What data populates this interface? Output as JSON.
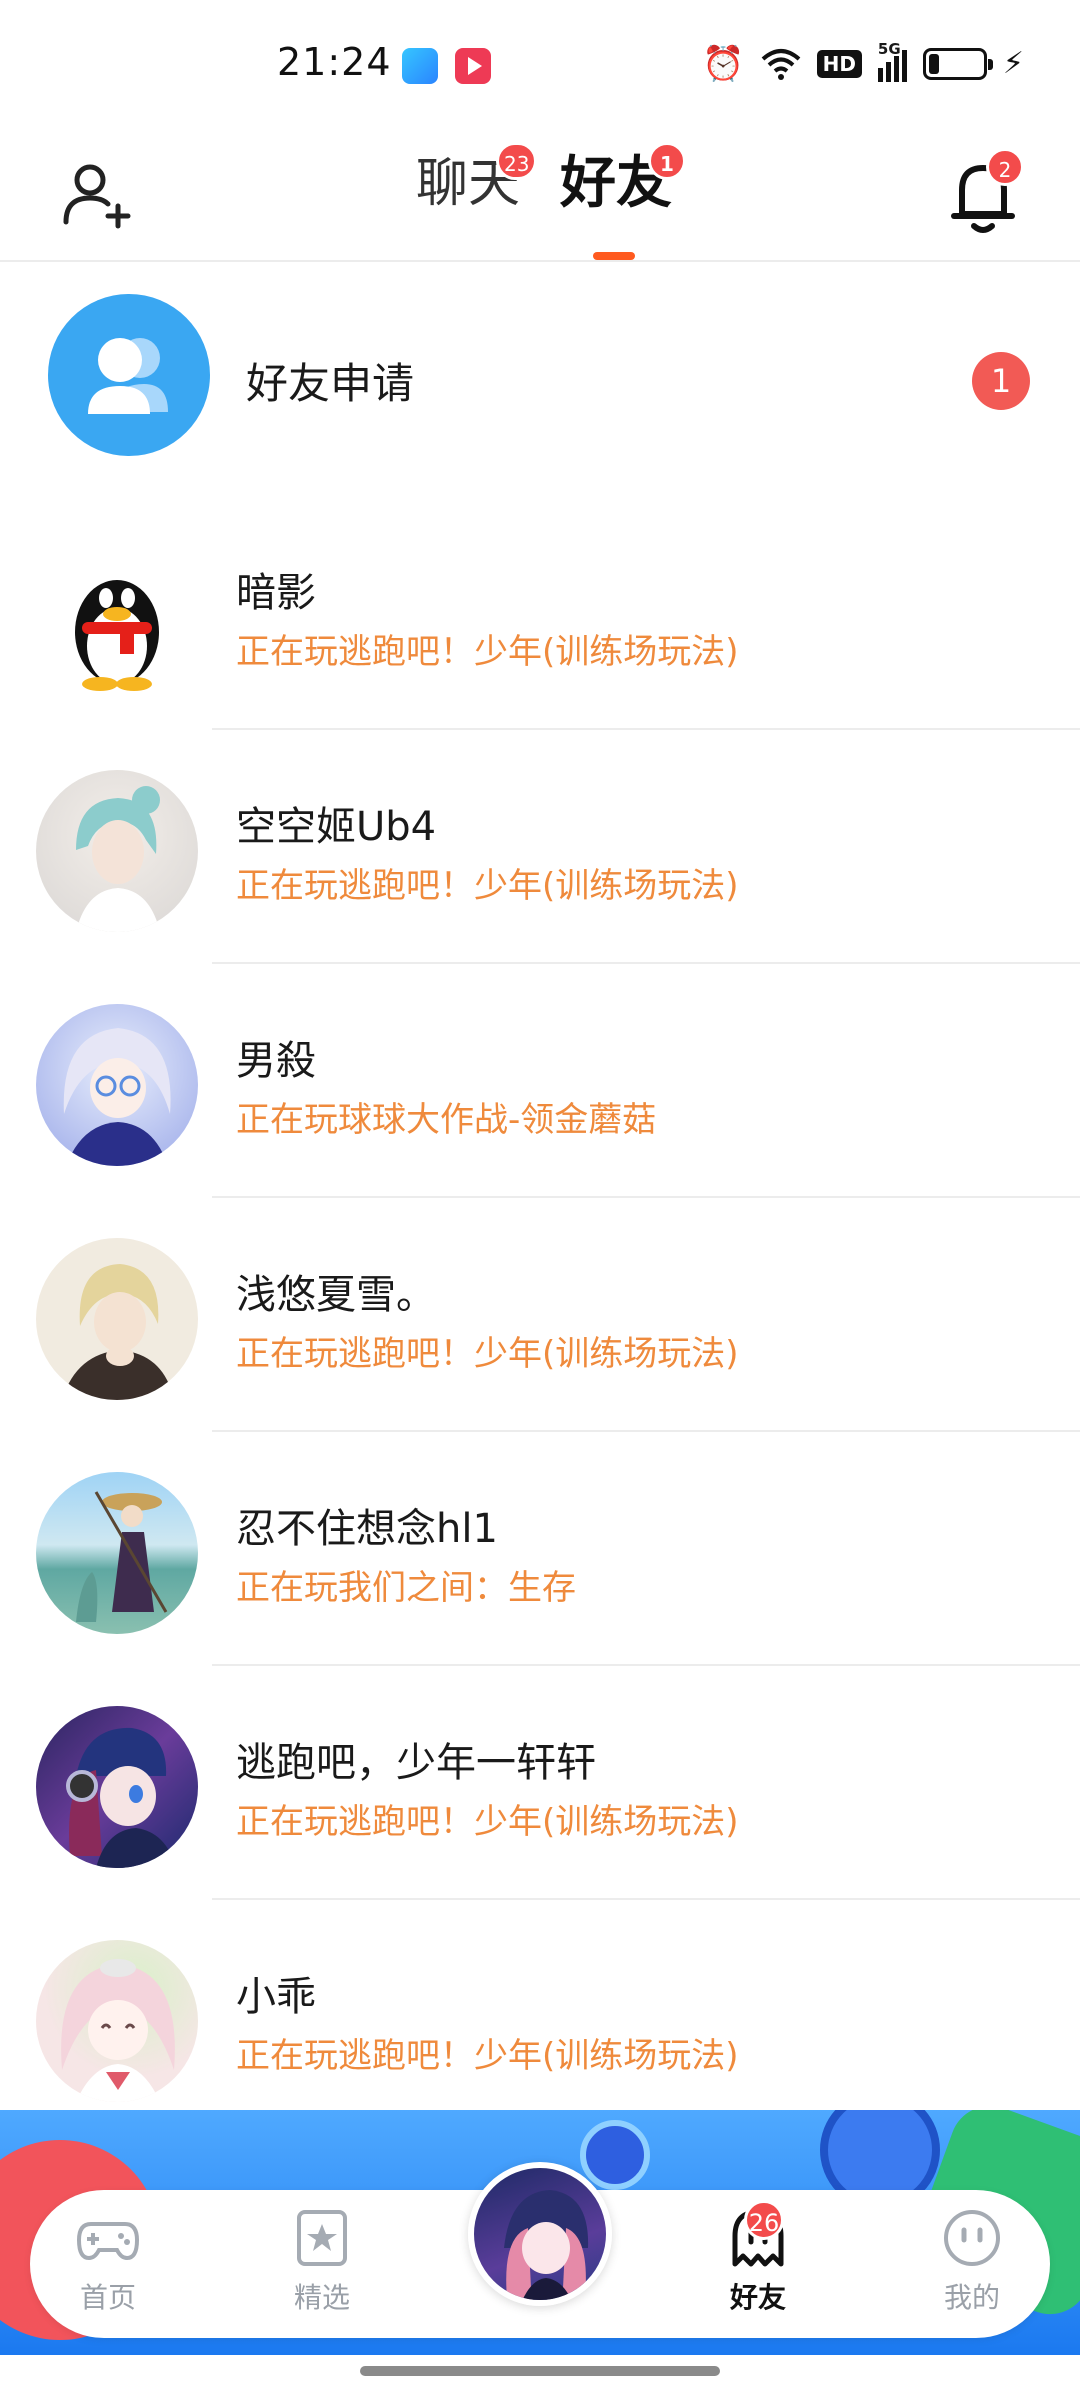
{
  "status_bar": {
    "time": "21:24",
    "network": "5G",
    "hd": "HD",
    "icons": [
      "telegram-app-icon",
      "video-app-icon",
      "alarm-icon",
      "wifi-icon",
      "hd-icon",
      "signal-icon",
      "battery-icon",
      "charging-icon"
    ]
  },
  "header": {
    "tabs": [
      {
        "label": "聊天",
        "badge": "23"
      },
      {
        "label": "好友",
        "badge": "1",
        "active": true
      }
    ],
    "bell_badge": "2",
    "accent": "#ff5a1f"
  },
  "friend_request": {
    "label": "好友申请",
    "badge": "1"
  },
  "friends": [
    {
      "name": "暗影",
      "status": "正在玩逃跑吧！少年(训练场玩法)",
      "avatar": "qq-penguin-avatar"
    },
    {
      "name": "空空姬Ub4",
      "status": "正在玩逃跑吧！少年(训练场玩法)",
      "avatar": "anime-boy-blue-hair-avatar"
    },
    {
      "name": "男殺",
      "status": "正在玩球球大作战-领金蘑菇",
      "avatar": "anime-girl-glasses-avatar"
    },
    {
      "name": "浅悠夏雪。",
      "status": "正在玩逃跑吧！少年(训练场玩法)",
      "avatar": "anime-boy-blonde-avatar"
    },
    {
      "name": "忍不住想念hl1",
      "status": "正在玩我们之间：生存",
      "avatar": "anime-girl-sea-avatar"
    },
    {
      "name": "逃跑吧，少年一轩轩",
      "status": "正在玩逃跑吧！少年(训练场玩法)",
      "avatar": "anime-girl-headphones-avatar"
    },
    {
      "name": "小乖",
      "status": "正在玩逃跑吧！少年(训练场玩法)",
      "avatar": "anime-girl-pink-hair-avatar"
    }
  ],
  "bottom_nav": {
    "items": [
      {
        "label": "首页",
        "icon": "gamepad-icon"
      },
      {
        "label": "精选",
        "icon": "star-bookmark-icon"
      },
      {
        "label": "好友",
        "icon": "ghost-icon",
        "badge": "26",
        "active": true
      },
      {
        "label": "我的",
        "icon": "face-icon"
      }
    ],
    "center_avatar": "user-avatar"
  },
  "colors": {
    "status_text": "#ef8a3c",
    "badge": "#f34b4b",
    "request_avatar": "#3aa7f2"
  }
}
